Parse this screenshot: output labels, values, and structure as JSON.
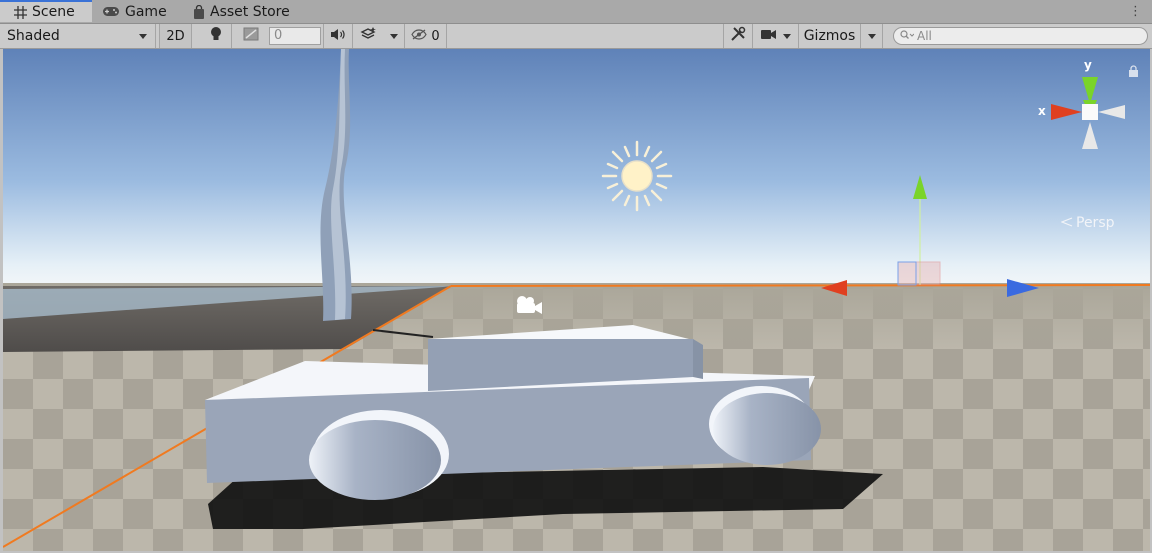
{
  "tabs": [
    {
      "label": "Scene",
      "icon": "grid-icon",
      "active": true
    },
    {
      "label": "Game",
      "icon": "gamepad-icon",
      "active": false
    },
    {
      "label": "Asset Store",
      "icon": "shopping-bag-icon",
      "active": false
    }
  ],
  "toolbar": {
    "draw_mode": "Shaded",
    "mode_2d": "2D",
    "grid_snap_value": "0",
    "hidden_count": "0",
    "gizmos_label": "Gizmos",
    "search_placeholder": "All"
  },
  "gizmo": {
    "x_label": "x",
    "y_label": "y",
    "projection": "Persp"
  },
  "colors": {
    "tab_accent": "#3a72d6",
    "x_axis": "#e8502a",
    "y_axis": "#7ad42a",
    "z_axis": "#3a6ae0",
    "selection_outline": "#f07a20"
  }
}
